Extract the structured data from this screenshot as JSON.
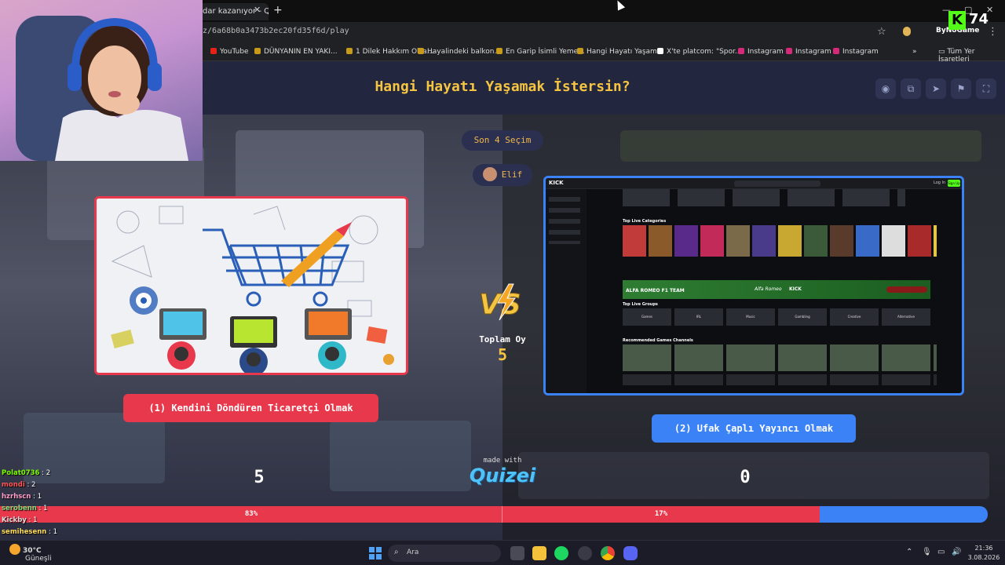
{
  "browser": {
    "tab_title": "dar kazanıyor - Q",
    "tab_close": "✕",
    "new_tab": "+",
    "url": "z/6a68b0a3473b2ec20fd35f6d/play",
    "window_controls": [
      "—",
      "▢",
      "✕"
    ],
    "bookmarks": [
      {
        "label": "YouTube",
        "icon_color": "#e62117"
      },
      {
        "label": "DÜNYANIN EN YAKI...",
        "icon_color": "#c79a1a"
      },
      {
        "label": "1 Dilek Hakkım Olsa...",
        "icon_color": "#c79a1a"
      },
      {
        "label": "Hayalindeki balkon...",
        "icon_color": "#c79a1a"
      },
      {
        "label": "En Garip İsimli Yeme...",
        "icon_color": "#c79a1a"
      },
      {
        "label": "Hangi Hayatı Yaşam...",
        "icon_color": "#c79a1a"
      },
      {
        "label": "X'te platcom: \"Spor...",
        "icon_color": "#ffffff"
      },
      {
        "label": "Instagram",
        "icon_color": "#d6297a"
      },
      {
        "label": "Instagram",
        "icon_color": "#d6297a"
      },
      {
        "label": "Instagram",
        "icon_color": "#d6297a"
      }
    ],
    "bookmarks_more": "»",
    "all_bookmarks": "Tüm Yer İşaretleri"
  },
  "game": {
    "title": "Hangi Hayatı Yaşamak İstersin?",
    "last_choices": "Son 4 Seçim",
    "player_name": "Elif",
    "option_left_label": "(1) Kendini Döndüren Ticaretçi Olmak",
    "option_right_label": "(2) Ufak Çaplı Yayıncı Olmak",
    "vs_text": "VS",
    "total_label": "Toplam Oy",
    "total_value": "5",
    "left_count": "5",
    "right_count": "0",
    "left_percent_label": "83%",
    "right_percent_label": "17%",
    "left_percent": 83,
    "made_with": "made with",
    "brand": "Quizei",
    "top_icons": [
      "eye-icon",
      "copy-icon",
      "send-icon",
      "flag-icon",
      "fullscreen-icon"
    ]
  },
  "kick_preview": {
    "logo": "KICK",
    "top_live_categories": "Top Live Categories",
    "promo": "ALFA ROMEO F1 TEAM",
    "promo_sub": "Alfa Romeo",
    "top_live_groups": "Top Live Groups",
    "groups": [
      "Games",
      "IRL",
      "Music",
      "Gambling",
      "Creative",
      "Alternative"
    ],
    "recommended": "Recommended Games Channels",
    "login": "Log In",
    "signup": "Sign Up"
  },
  "overlay": {
    "brand": "ByNoGame",
    "kick_letter": "K",
    "kick_count": "74"
  },
  "chat": [
    {
      "user": "Polat0736",
      "msg": "2",
      "color": "#7CFC00"
    },
    {
      "user": "mondi",
      "msg": "2",
      "color": "#ff5555"
    },
    {
      "user": "hzrhscn",
      "msg": "1",
      "color": "#ff9ecb"
    },
    {
      "user": "serobenn",
      "msg": "1",
      "color": "#7ddc7d"
    },
    {
      "user": "Kickby",
      "msg": "1",
      "color": "#dddddd"
    },
    {
      "user": "semihesenn",
      "msg": "1",
      "color": "#ffde59"
    }
  ],
  "taskbar": {
    "temp": "30°C",
    "weather": "Güneşli",
    "search": "Ara",
    "time": "21:36",
    "date": "3.08.2026"
  }
}
